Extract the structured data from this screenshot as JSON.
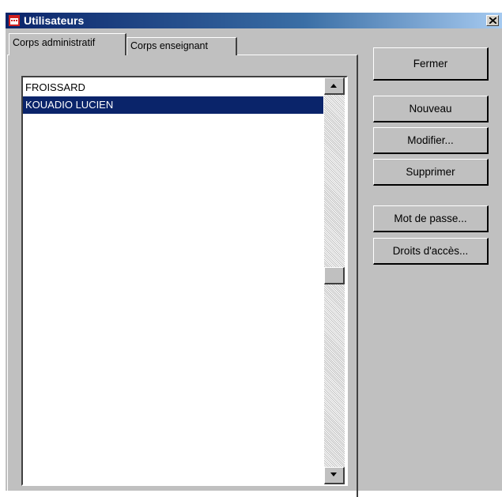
{
  "window": {
    "title": "Utilisateurs"
  },
  "tabs": [
    {
      "label": "Corps administratif",
      "active": true
    },
    {
      "label": "Corps enseignant",
      "active": false
    }
  ],
  "list": {
    "items": [
      {
        "label": "FROISSARD",
        "selected": false
      },
      {
        "label": "KOUADIO LUCIEN",
        "selected": true
      }
    ]
  },
  "buttons": {
    "close_label": "Fermer",
    "new_label": "Nouveau",
    "edit_label": "Modifier...",
    "delete_label": "Supprimer",
    "password_label": "Mot de passe...",
    "rights_label": "Droits d'accès..."
  },
  "colors": {
    "title_bar": "#0a246a",
    "selection": "#0a246a",
    "face": "#c0c0c0"
  }
}
